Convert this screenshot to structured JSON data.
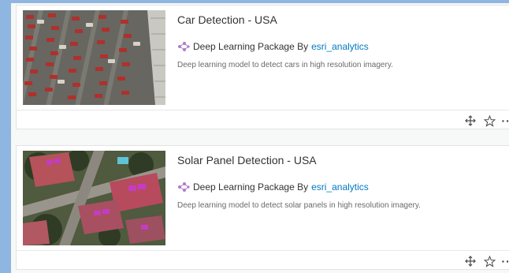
{
  "items": [
    {
      "title": "Car Detection - USA",
      "type_label": "Deep Learning Package By",
      "owner": "esri_analytics",
      "description": "Deep learning model to detect cars in high resolution imagery.",
      "thumbnail_icon": "parking-lot-aerial-image",
      "actions": [
        "move-icon",
        "star-icon",
        "more-options-icon"
      ]
    },
    {
      "title": "Solar Panel Detection - USA",
      "type_label": "Deep Learning Package By",
      "owner": "esri_analytics",
      "description": "Deep learning model to detect solar panels in high resolution imagery.",
      "thumbnail_icon": "rooftops-aerial-image",
      "actions": [
        "move-icon",
        "star-icon",
        "more-options-icon"
      ]
    }
  ],
  "colors": {
    "link": "#0079c1",
    "title": "#323232",
    "description": "#6a6a6a",
    "page_background": "#8fb6e0",
    "list_background": "#f7f8f8",
    "card_border": "#e3e3e3"
  }
}
